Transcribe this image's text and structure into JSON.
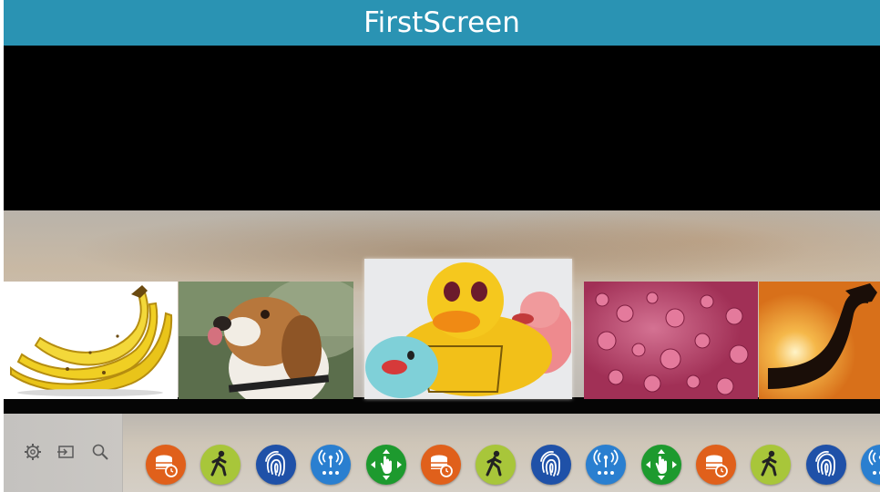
{
  "app": {
    "title": "FirstScreen"
  },
  "toolbar": {
    "settings_icon": "gear-icon",
    "input_icon": "input-source-icon",
    "search_icon": "search-icon"
  },
  "carousel": {
    "items": [
      {
        "name": "banana",
        "selected": false
      },
      {
        "name": "beagle",
        "selected": false
      },
      {
        "name": "rubber-ducks",
        "selected": true
      },
      {
        "name": "water-droplets",
        "selected": false
      },
      {
        "name": "flexed-arm-silhouette",
        "selected": false
      }
    ]
  },
  "apps": {
    "items": [
      {
        "icon": "database-clock-icon",
        "color": "#e0601b"
      },
      {
        "icon": "walking-person-icon",
        "color": "#a8c63a"
      },
      {
        "icon": "fingerprint-icon",
        "color": "#1f51a8"
      },
      {
        "icon": "broadcast-antenna-icon",
        "color": "#2a7fd0"
      },
      {
        "icon": "touch-gesture-icon",
        "color": "#1d9a2e"
      },
      {
        "icon": "database-clock-icon",
        "color": "#e0601b"
      },
      {
        "icon": "walking-person-icon",
        "color": "#a8c63a"
      },
      {
        "icon": "fingerprint-icon",
        "color": "#1f51a8"
      },
      {
        "icon": "broadcast-antenna-icon",
        "color": "#2a7fd0"
      },
      {
        "icon": "touch-gesture-icon",
        "color": "#1d9a2e"
      },
      {
        "icon": "database-clock-icon",
        "color": "#e0601b"
      },
      {
        "icon": "walking-person-icon",
        "color": "#a8c63a"
      },
      {
        "icon": "fingerprint-icon",
        "color": "#1f51a8"
      },
      {
        "icon": "broadcast-antenna-icon",
        "color": "#2a7fd0"
      }
    ]
  }
}
